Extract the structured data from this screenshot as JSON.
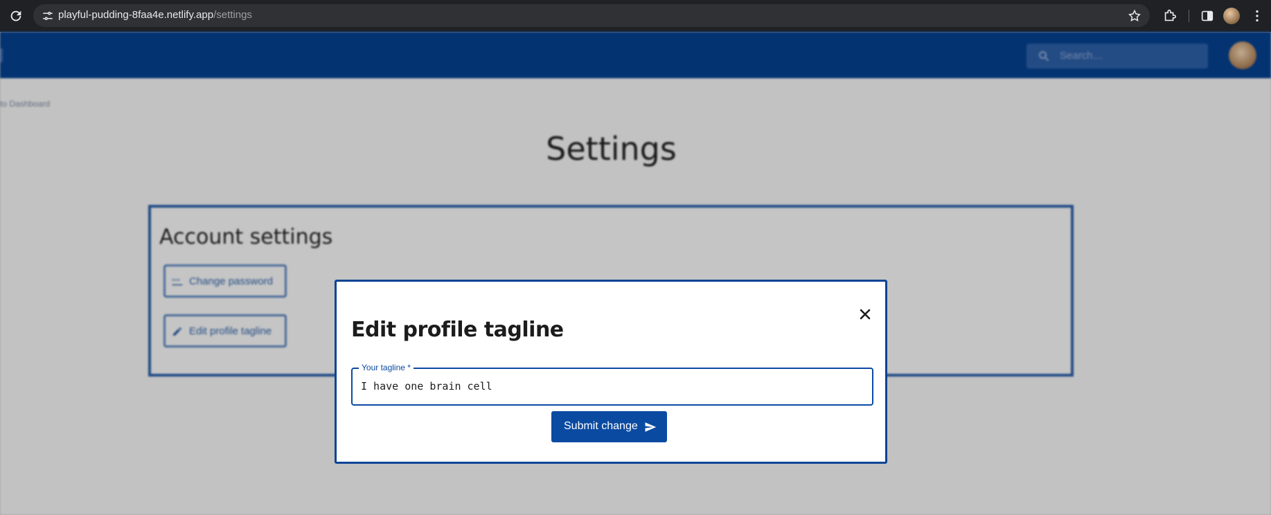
{
  "browser": {
    "url_host": "playful-pudding-8faa4e.netlify.app",
    "url_path": "/settings"
  },
  "app": {
    "search_placeholder": "Search…",
    "back_link": "to Dashboard",
    "page_title": "Settings",
    "card_title": "Account settings",
    "buttons": {
      "change_password": "Change password",
      "edit_tagline": "Edit profile tagline"
    }
  },
  "modal": {
    "title": "Edit profile tagline",
    "field_label": "Your tagline *",
    "field_value": "I have one brain cell",
    "submit_label": "Submit change"
  },
  "colors": {
    "brand": "#05408f",
    "modal_border": "#084395",
    "button": "#0a4aa1"
  },
  "icons": {
    "reload": "reload-icon",
    "site_info": "tune-icon",
    "bookmark": "star-icon",
    "extensions": "puzzle-icon",
    "side_panel": "side-panel-icon",
    "menu": "kebab-menu-icon",
    "search": "search-icon",
    "password": "password-icon",
    "edit": "pencil-icon",
    "close": "close-icon",
    "send": "send-icon"
  }
}
